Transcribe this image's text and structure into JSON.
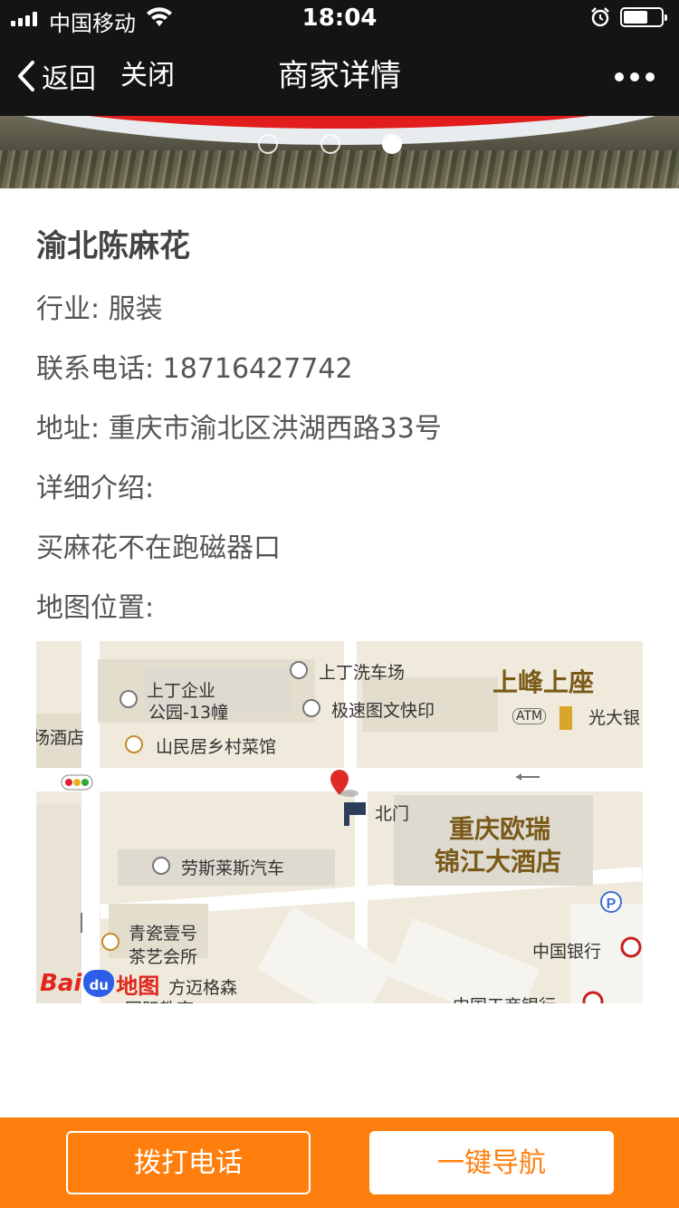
{
  "status_bar": {
    "carrier": "中国移动",
    "time": "18:04"
  },
  "nav": {
    "back_label": "返回",
    "close_label": "关闭",
    "title": "商家详情"
  },
  "banner": {
    "slide_count": 3,
    "active_index": 2
  },
  "merchant": {
    "name": "渝北陈麻花",
    "industry_line": "行业: 服装",
    "phone_line": "联系电话: 18716427742",
    "address_line": "地址: 重庆市渝北区洪湖西路33号",
    "intro_label": "详细介绍:",
    "intro_text": "买麻花不在跑磁器口",
    "map_label": "地图位置:"
  },
  "map": {
    "labels": {
      "park": "上丁企业",
      "park2": "公园-13幢",
      "carwash": "上丁洗车场",
      "print": "极速图文快印",
      "hotel_partial": "场酒店",
      "restaurant": "山民居乡村菜馆",
      "north_gate": "北门",
      "rolls": "劳斯莱斯汽车",
      "tea": "青瓷壹号",
      "tea2": "茶艺会所",
      "school": "方迈格森",
      "school2": "国际教育",
      "boc": "中国银行",
      "icbc": "中国工商银行",
      "everbright": "光大银",
      "atm": "ATM",
      "parking": "P"
    },
    "big_labels": {
      "shangfeng": "上峰上座",
      "hotel1": "重庆欧瑞",
      "hotel2": "锦江大酒店"
    },
    "logo": {
      "bai": "Bai",
      "du": "du",
      "ditu": "地图"
    }
  },
  "actions": {
    "call_label": "拨打电话",
    "navigate_label": "一键导航"
  }
}
